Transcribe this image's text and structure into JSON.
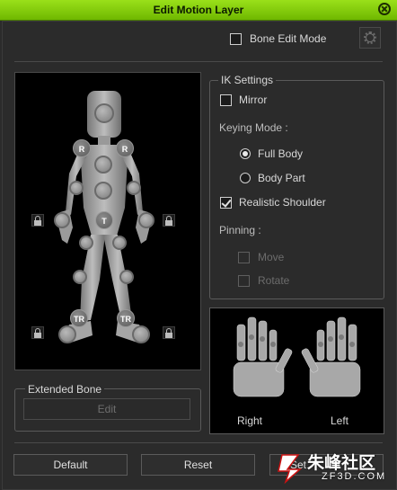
{
  "window": {
    "title": "Edit Motion Layer"
  },
  "bone_edit_mode": {
    "label": "Bone Edit Mode",
    "checked": false
  },
  "ik_settings": {
    "title": "IK Settings",
    "mirror_label": "Mirror",
    "keying_mode_label": "Keying Mode :",
    "full_body_label": "Full Body",
    "body_part_label": "Body Part",
    "realistic_shoulder_label": "Realistic Shoulder",
    "pinning_label": "Pinning :",
    "move_label": "Move",
    "rotate_label": "Rotate"
  },
  "figure": {
    "markers": {
      "r": "R",
      "t": "T",
      "tr": "TR"
    }
  },
  "hands": {
    "right_label": "Right",
    "left_label": "Left"
  },
  "extended_bone": {
    "title": "Extended Bone",
    "edit_label": "Edit"
  },
  "footer": {
    "default_label": "Default",
    "reset_label": "Reset",
    "set_label": "Set"
  },
  "watermark": {
    "text": "朱峰社区",
    "url": "ZF3D.COM"
  }
}
